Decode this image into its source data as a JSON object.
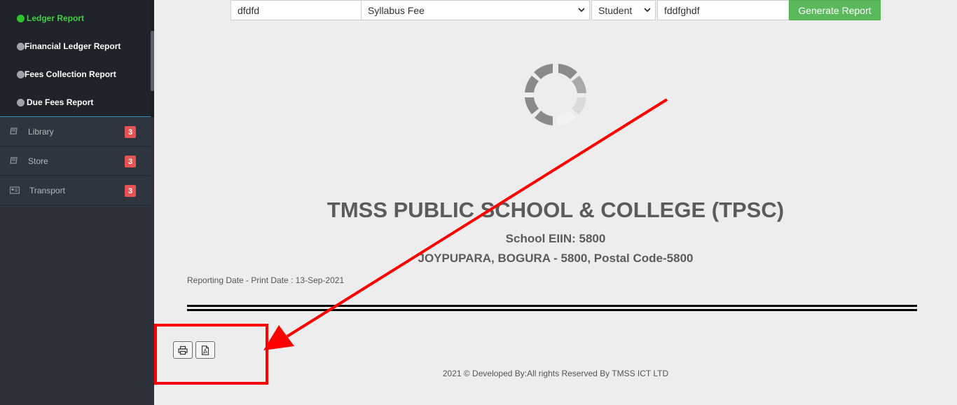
{
  "sidebar": {
    "submenu": [
      {
        "label": "Ledger Report",
        "active": true
      },
      {
        "label": "Financial Ledger Report",
        "active": false
      },
      {
        "label": "Fees Collection Report",
        "active": false
      },
      {
        "label": "Due Fees Report",
        "active": false
      }
    ],
    "menu": [
      {
        "label": "Library",
        "badge": "3",
        "icon": "book-icon"
      },
      {
        "label": "Store",
        "badge": "3",
        "icon": "book-icon"
      },
      {
        "label": "Transport",
        "badge": "3",
        "icon": "id-card-icon"
      }
    ]
  },
  "filters": {
    "text1_value": "dfdfd",
    "fee_type_value": "Syllabus Fee",
    "person_type_value": "Student",
    "text2_value": "fddfghdf",
    "generate_label": "Generate Report"
  },
  "report": {
    "school_name": "TMSS PUBLIC SCHOOL & COLLEGE (TPSC)",
    "eiin": "School EIIN: 5800",
    "address": "JOYPUPARA, BOGURA - 5800, Postal Code-5800",
    "reporting_date": "Reporting Date - Print Date : 13-Sep-2021"
  },
  "actions": {
    "print_icon": "printer-icon",
    "pdf_icon": "pdf-icon"
  },
  "footer": {
    "text": "2021 © Developed By:All rights Reserved By TMSS ICT LTD"
  },
  "colors": {
    "sidebar_bg": "#2c313a",
    "active_green": "#41d141",
    "badge_red": "#e55353",
    "button_green": "#5cb85c",
    "annotation_red": "#ff0000"
  }
}
